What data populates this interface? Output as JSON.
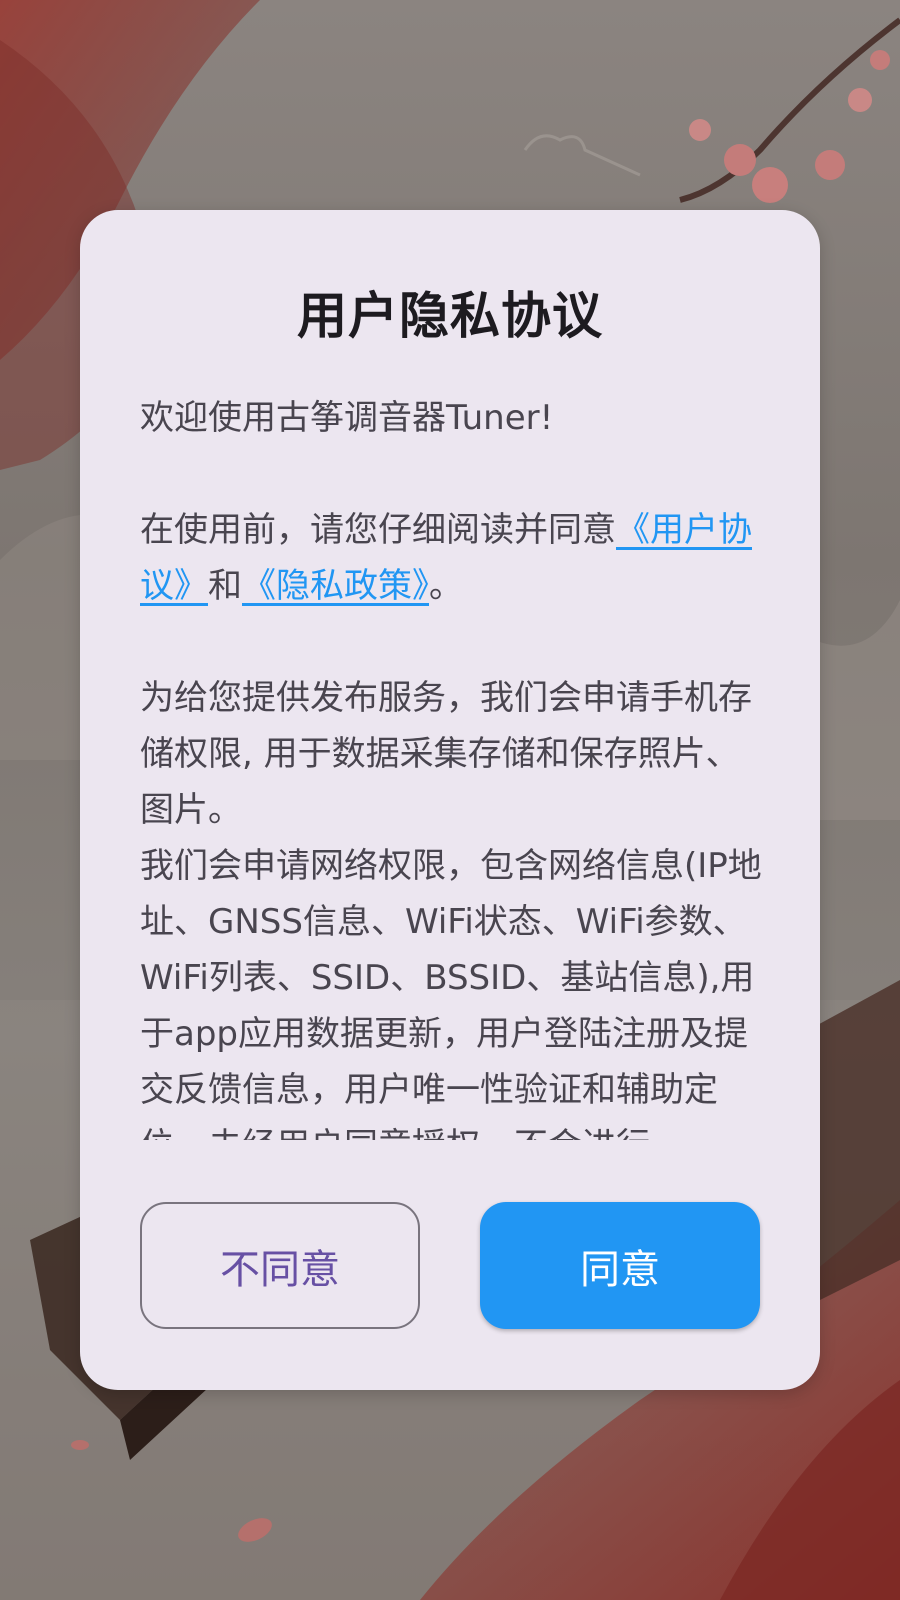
{
  "dialog": {
    "title": "用户隐私协议",
    "welcome": "欢迎使用古筝调音器Tuner!",
    "intro_prefix": "在使用前，请您仔细阅读并同意",
    "user_agreement_link": "《用户协议》",
    "intro_and": "和",
    "privacy_policy_link": "《隐私政策》",
    "intro_suffix": "。",
    "storage_permission": "为给您提供发布服务，我们会申请手机存储权限, 用于数据采集存储和保存照片、图片。",
    "network_permission": "我们会申请网络权限，包含网络信息(IP地址、GNSS信息、WiFi状态、WiFi参数、WiFi列表、SSID、BSSID、基站信息),用于app应用数据更新，用户登陆注册及提交反馈信息，用户唯一性验证和辅助定位，未经用户同意授权，不会进行",
    "decline_label": "不同意",
    "agree_label": "同意"
  },
  "colors": {
    "dialog_bg": "#ece6f0",
    "link": "#2196f3",
    "agree_button": "#2196f3",
    "decline_text": "#6750a4"
  }
}
